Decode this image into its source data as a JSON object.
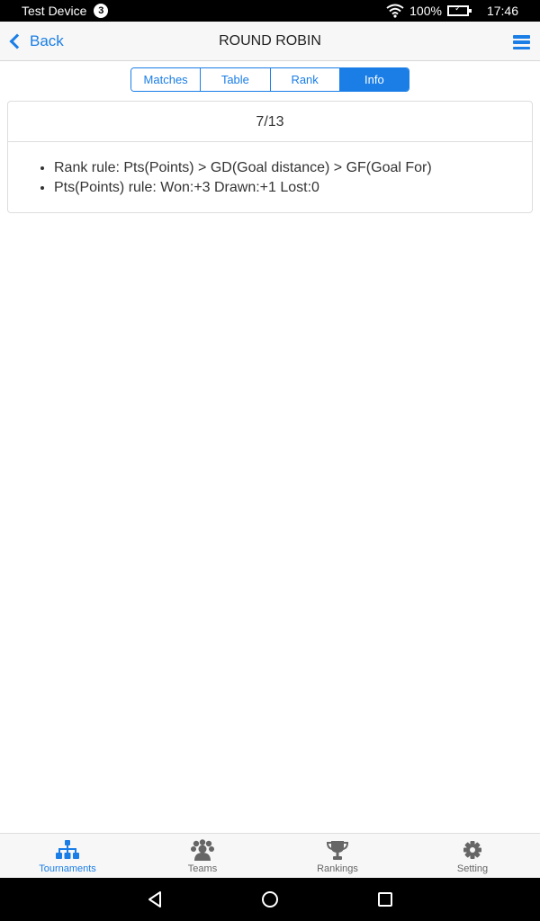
{
  "status_bar": {
    "device_name": "Test Device",
    "notification_count": "3",
    "battery": "100%",
    "time": "17:46"
  },
  "nav": {
    "back_label": "Back",
    "title": "ROUND ROBIN"
  },
  "segments": [
    {
      "label": "Matches",
      "active": false
    },
    {
      "label": "Table",
      "active": false
    },
    {
      "label": "Rank",
      "active": false
    },
    {
      "label": "Info",
      "active": true
    }
  ],
  "info_card": {
    "header": "7/13",
    "rules": [
      "Rank rule: Pts(Points) > GD(Goal distance) > GF(Goal For)",
      "Pts(Points) rule: Won:+3 Drawn:+1 Lost:0"
    ]
  },
  "tabbar": {
    "items": [
      {
        "label": "Tournaments",
        "icon": "sitemap-icon",
        "active": true
      },
      {
        "label": "Teams",
        "icon": "users-icon",
        "active": false
      },
      {
        "label": "Rankings",
        "icon": "trophy-icon",
        "active": false
      },
      {
        "label": "Setting",
        "icon": "gear-icon",
        "active": false
      }
    ]
  },
  "colors": {
    "accent": "#1a7ee6",
    "inactive": "#666666"
  }
}
